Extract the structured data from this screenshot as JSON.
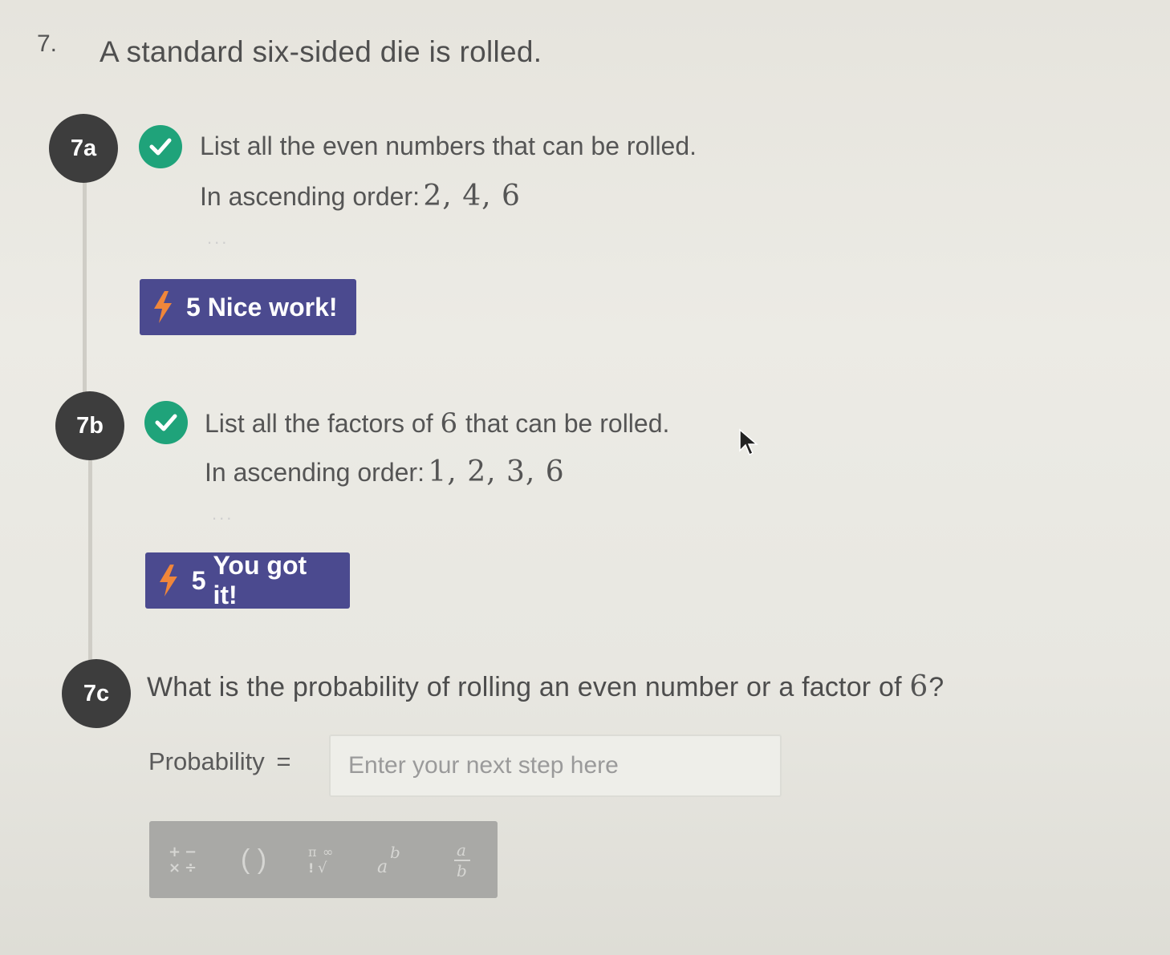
{
  "question": {
    "number": "7.",
    "title": "A standard six-sided die is rolled."
  },
  "parts": [
    {
      "badge": "7a",
      "status_icon": "check-circle-icon",
      "prompt": "List all the even numbers that can be rolled.",
      "answer_prefix": "In ascending order:",
      "answer_value": "2, 4, 6",
      "more": "...",
      "reward_points": "5",
      "reward_text": "Nice work!"
    },
    {
      "badge": "7b",
      "status_icon": "check-circle-icon",
      "prompt_before": "List all the factors of",
      "prompt_math": "6",
      "prompt_after": "that can be rolled.",
      "answer_prefix": "In ascending order:",
      "answer_value": "1, 2, 3, 6",
      "more": "...",
      "reward_points": "5",
      "reward_text": "You got it!"
    },
    {
      "badge": "7c",
      "prompt_before": "What is the probability of rolling an even number or a factor of",
      "prompt_math": "6",
      "prompt_after": "?",
      "input_label": "Probability",
      "input_equals": "=",
      "input_placeholder": "Enter your next step here"
    }
  ],
  "math_toolbar": {
    "buttons": [
      "operators-icon",
      "parentheses-icon",
      "symbols-icon",
      "exponent-icon",
      "fraction-icon"
    ],
    "labels": {
      "parentheses": "( )"
    }
  },
  "colors": {
    "badge": "#3d3d3d",
    "check": "#1fa37a",
    "reward": "#4b4a8f",
    "bolt": "#f0863a"
  }
}
